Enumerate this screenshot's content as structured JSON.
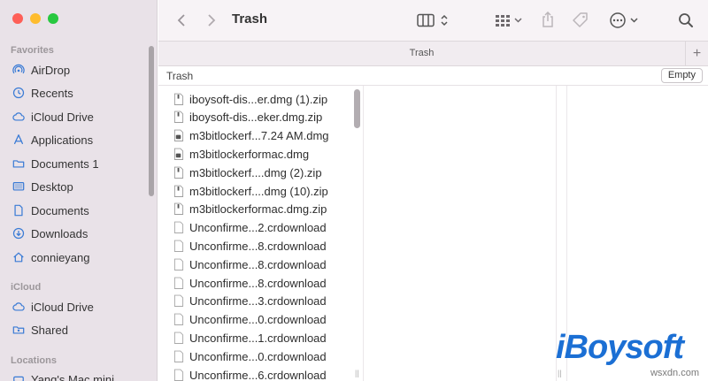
{
  "window": {
    "title": "Trash"
  },
  "tab": {
    "label": "Trash",
    "new_tab": "+"
  },
  "pathbar": {
    "title": "Trash",
    "empty_button": "Empty"
  },
  "sidebar": {
    "favorites_header": "Favorites",
    "favorites": [
      {
        "label": "AirDrop",
        "icon": "airdrop-icon"
      },
      {
        "label": "Recents",
        "icon": "clock-icon"
      },
      {
        "label": "iCloud Drive",
        "icon": "cloud-icon"
      },
      {
        "label": "Applications",
        "icon": "applications-icon"
      },
      {
        "label": "Documents 1",
        "icon": "folder-icon"
      },
      {
        "label": "Desktop",
        "icon": "desktop-icon"
      },
      {
        "label": "Documents",
        "icon": "document-icon"
      },
      {
        "label": "Downloads",
        "icon": "download-icon"
      },
      {
        "label": "connieyang",
        "icon": "home-icon"
      }
    ],
    "icloud_header": "iCloud",
    "icloud": [
      {
        "label": "iCloud Drive",
        "icon": "cloud-icon"
      },
      {
        "label": "Shared",
        "icon": "shared-folder-icon"
      }
    ],
    "locations_header": "Locations",
    "locations": [
      {
        "label": "Yang's Mac mini",
        "icon": "computer-icon"
      }
    ]
  },
  "files": [
    {
      "name": "iboysoft-dis...er.dmg (1).zip",
      "icon": "zip-file-icon"
    },
    {
      "name": "iboysoft-dis...eker.dmg.zip",
      "icon": "zip-file-icon"
    },
    {
      "name": "m3bitlockerf...7.24 AM.dmg",
      "icon": "dmg-file-icon"
    },
    {
      "name": "m3bitlockerformac.dmg",
      "icon": "dmg-file-icon"
    },
    {
      "name": "m3bitlockerf....dmg (2).zip",
      "icon": "zip-file-icon"
    },
    {
      "name": "m3bitlockerf....dmg (10).zip",
      "icon": "zip-file-icon"
    },
    {
      "name": "m3bitlockerformac.dmg.zip",
      "icon": "zip-file-icon"
    },
    {
      "name": "Unconfirme...2.crdownload",
      "icon": "blank-file-icon"
    },
    {
      "name": "Unconfirme...8.crdownload",
      "icon": "blank-file-icon"
    },
    {
      "name": "Unconfirme...8.crdownload",
      "icon": "blank-file-icon"
    },
    {
      "name": "Unconfirme...8.crdownload",
      "icon": "blank-file-icon"
    },
    {
      "name": "Unconfirme...3.crdownload",
      "icon": "blank-file-icon"
    },
    {
      "name": "Unconfirme...0.crdownload",
      "icon": "blank-file-icon"
    },
    {
      "name": "Unconfirme...1.crdownload",
      "icon": "blank-file-icon"
    },
    {
      "name": "Unconfirme...0.crdownload",
      "icon": "blank-file-icon"
    },
    {
      "name": "Unconfirme...6.crdownload",
      "icon": "blank-file-icon"
    }
  ],
  "watermark": {
    "logo": "iBoysoft",
    "site": "wsxdn.com"
  },
  "colors": {
    "sidebar_bg": "#e9e2e8",
    "accent_icon": "#3a7bd5",
    "logo_blue": "#1b6fd4"
  }
}
